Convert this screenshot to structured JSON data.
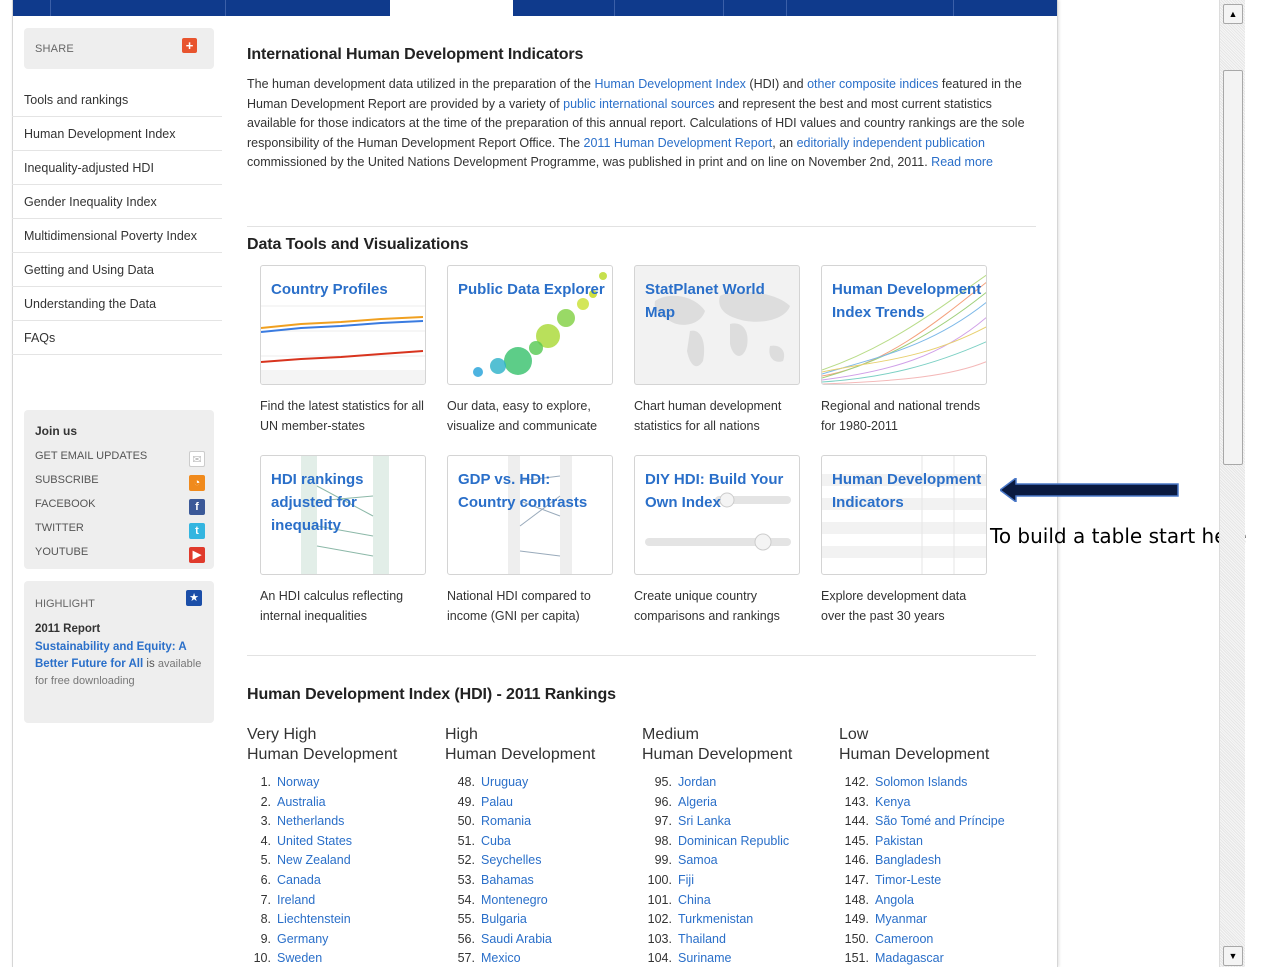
{
  "sidebar": {
    "share_label": "SHARE",
    "nav": [
      "Tools and rankings",
      "Human Development Index",
      "Inequality-adjusted HDI",
      "Gender Inequality Index",
      "Multidimensional Poverty Index",
      "Getting and Using Data",
      "Understanding the Data",
      "FAQs"
    ],
    "join": {
      "title": "Join us",
      "items": [
        "GET EMAIL UPDATES",
        "SUBSCRIBE",
        "FACEBOOK",
        "TWITTER",
        "YOUTUBE"
      ]
    },
    "highlight": {
      "title": "HIGHLIGHT",
      "report": "2011 Report",
      "link": "Sustainability and Equity: A Better Future for All",
      "is": " is",
      "tail": "available for free downloading"
    }
  },
  "intro": {
    "title": "International Human Development Indicators",
    "p1": "The human development data utilized in the preparation of the ",
    "l1": "Human Development Index",
    "p2": " (HDI) and ",
    "l2": "other composite indices",
    "p3": " featured in the Human Development Report are provided by a variety of ",
    "l3": "public international sources",
    "p4": " and represent the best and most current statistics available for those indicators at the time of the preparation of this annual report. Calculations of HDI values and country rankings are the sole responsibility of the Human Development Report Office. The ",
    "l4": "2011 Human Development Report",
    "p5": ", an ",
    "l5": "editorially independent publication",
    "p6": " commissioned by the United Nations Development Programme, was published in print and on line on November 2nd, 2011. ",
    "l6": "Read more"
  },
  "tools": {
    "title": "Data Tools and Visualizations",
    "items": [
      {
        "title": "Country Profiles",
        "cap": "Find the latest statistics for all UN member-states"
      },
      {
        "title": "Public Data Explorer",
        "cap": "Our data, easy to explore, visualize and communicate"
      },
      {
        "title": "StatPlanet World Map",
        "cap": "Chart human development statistics for all nations"
      },
      {
        "title": "Human Development Index Trends",
        "cap": "Regional and national trends for 1980-2011"
      },
      {
        "title": "HDI rankings adjusted for inequality",
        "cap": "An HDI calculus reflecting internal inequalities"
      },
      {
        "title": "GDP vs. HDI: Country contrasts",
        "cap": "National HDI compared to income (GNI per capita)"
      },
      {
        "title": "DIY HDI: Build Your Own Index",
        "cap": "Create unique country comparisons and rankings"
      },
      {
        "title": "Human Development Indicators",
        "cap": "Explore development data over the past 30 years"
      }
    ]
  },
  "rankings": {
    "title": "Human Development Index (HDI) - 2011 Rankings",
    "columns": [
      {
        "line1": "Very High",
        "line2": "Human Development",
        "rows": [
          [
            "1.",
            "Norway"
          ],
          [
            "2.",
            "Australia"
          ],
          [
            "3.",
            "Netherlands"
          ],
          [
            "4.",
            "United States"
          ],
          [
            "5.",
            "New Zealand"
          ],
          [
            "6.",
            "Canada"
          ],
          [
            "7.",
            "Ireland"
          ],
          [
            "8.",
            "Liechtenstein"
          ],
          [
            "9.",
            "Germany"
          ],
          [
            "10.",
            "Sweden"
          ]
        ]
      },
      {
        "line1": "High",
        "line2": "Human Development",
        "rows": [
          [
            "48.",
            "Uruguay"
          ],
          [
            "49.",
            "Palau"
          ],
          [
            "50.",
            "Romania"
          ],
          [
            "51.",
            "Cuba"
          ],
          [
            "52.",
            "Seychelles"
          ],
          [
            "53.",
            "Bahamas"
          ],
          [
            "54.",
            "Montenegro"
          ],
          [
            "55.",
            "Bulgaria"
          ],
          [
            "56.",
            "Saudi Arabia"
          ],
          [
            "57.",
            "Mexico"
          ]
        ]
      },
      {
        "line1": "Medium",
        "line2": "Human Development",
        "rows": [
          [
            "95.",
            "Jordan"
          ],
          [
            "96.",
            "Algeria"
          ],
          [
            "97.",
            "Sri Lanka"
          ],
          [
            "98.",
            "Dominican Republic"
          ],
          [
            "99.",
            "Samoa"
          ],
          [
            "100.",
            "Fiji"
          ],
          [
            "101.",
            "China"
          ],
          [
            "102.",
            "Turkmenistan"
          ],
          [
            "103.",
            "Thailand"
          ],
          [
            "104.",
            "Suriname"
          ]
        ]
      },
      {
        "line1": "Low",
        "line2": "Human Development",
        "rows": [
          [
            "142.",
            "Solomon Islands"
          ],
          [
            "143.",
            "Kenya"
          ],
          [
            "144.",
            "São Tomé and Príncipe"
          ],
          [
            "145.",
            "Pakistan"
          ],
          [
            "146.",
            "Bangladesh"
          ],
          [
            "147.",
            "Timor-Leste"
          ],
          [
            "148.",
            "Angola"
          ],
          [
            "149.",
            "Myanmar"
          ],
          [
            "150.",
            "Cameroon"
          ],
          [
            "151.",
            "Madagascar"
          ]
        ]
      }
    ]
  },
  "annotation": "To build a table start here",
  "colors": {
    "link": "#2a6fc9",
    "brand_bar": "#0f3a8c"
  }
}
